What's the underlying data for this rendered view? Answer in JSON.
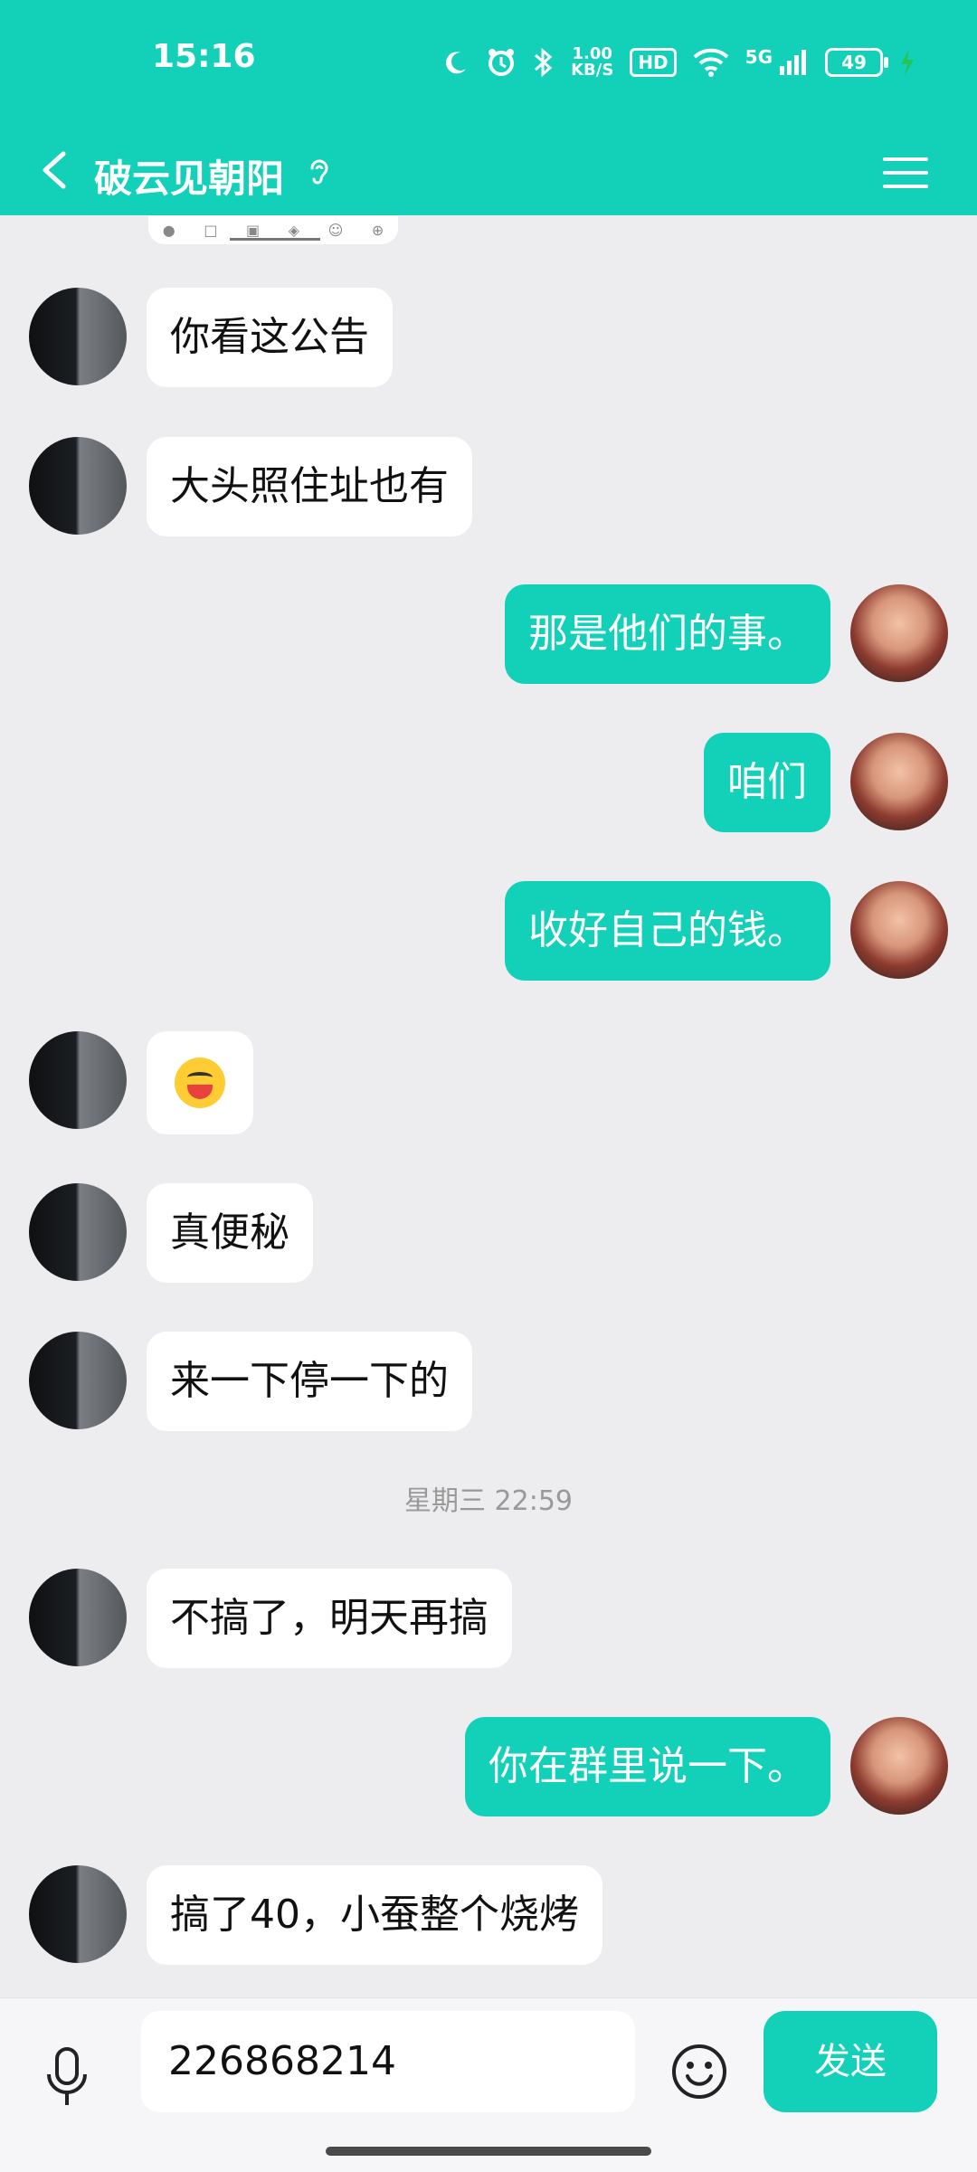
{
  "status": {
    "time": "15:16",
    "speed_top": "1.00",
    "speed_bottom": "KB/S",
    "hd": "HD",
    "signal": "5G",
    "battery": "49"
  },
  "header": {
    "title": "破云见朝阳"
  },
  "messages": [
    {
      "side": "in",
      "text": "你看这公告"
    },
    {
      "side": "in",
      "text": "大头照住址也有"
    },
    {
      "side": "out",
      "text": "那是他们的事。"
    },
    {
      "side": "out",
      "text": "咱们"
    },
    {
      "side": "out",
      "text": "收好自己的钱。"
    },
    {
      "side": "in",
      "type": "emoji",
      "icon": "eating-watermelon-emoji"
    },
    {
      "side": "in",
      "text": "真便秘"
    },
    {
      "side": "in",
      "text": "来一下停一下的"
    },
    {
      "type": "timestamp",
      "text": "星期三 22:59"
    },
    {
      "side": "in",
      "text": "不搞了，明天再搞"
    },
    {
      "side": "out",
      "text": "你在群里说一下。"
    },
    {
      "side": "in",
      "text": "搞了40，小蚕整个烧烤"
    }
  ],
  "composer": {
    "value": "226868214",
    "send_label": "发送"
  },
  "colors": {
    "accent": "#12D1B8",
    "background": "#EDEDF0"
  }
}
